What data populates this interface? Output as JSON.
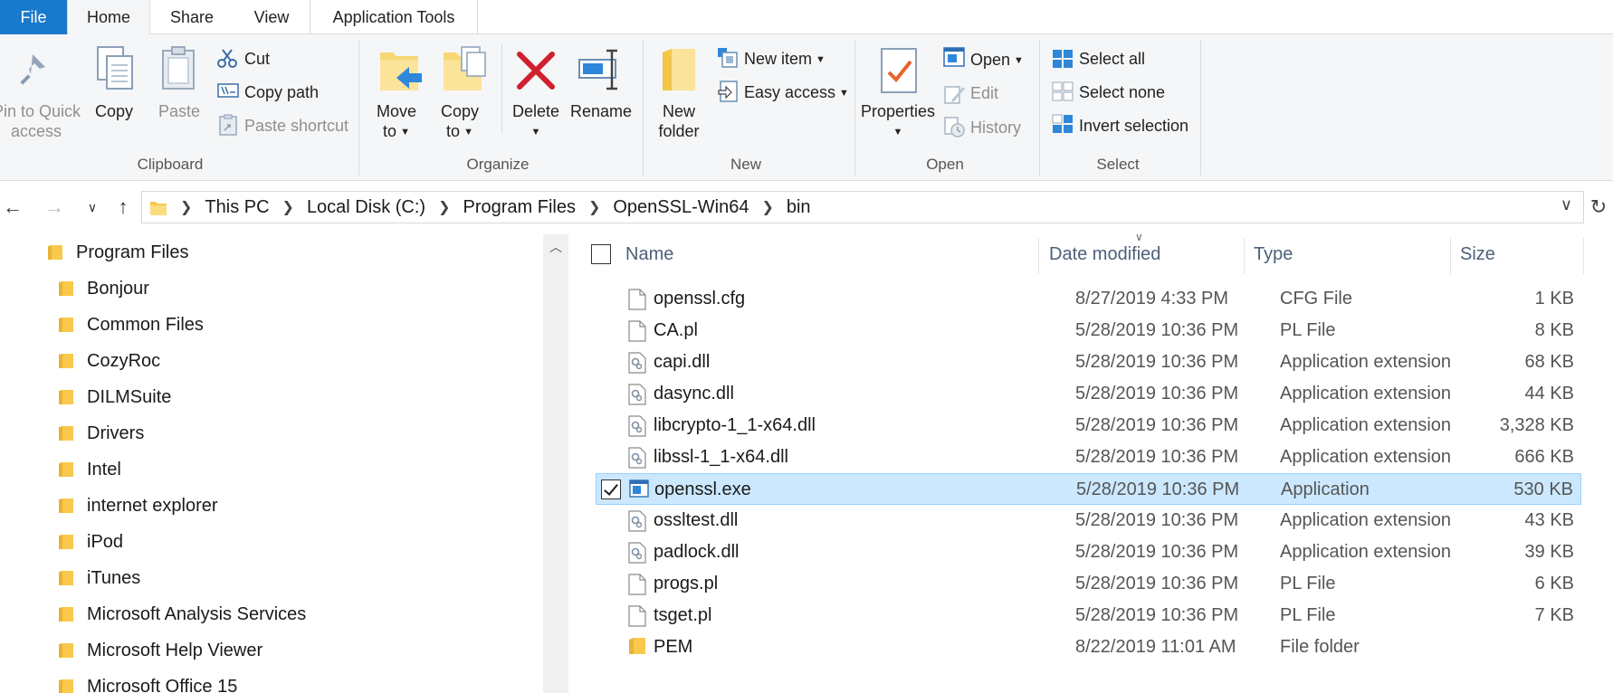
{
  "tabs": {
    "file": "File",
    "home": "Home",
    "share": "Share",
    "view": "View",
    "app_tools": "Application Tools"
  },
  "ribbon": {
    "clipboard": {
      "group_title": "Clipboard",
      "pin_line1": "Pin to Quick",
      "pin_line2": "access",
      "copy": "Copy",
      "paste": "Paste",
      "cut": "Cut",
      "copy_path": "Copy path",
      "paste_shortcut": "Paste shortcut"
    },
    "organize": {
      "group_title": "Organize",
      "move_to_line1": "Move",
      "move_to_line2": "to",
      "copy_to_line1": "Copy",
      "copy_to_line2": "to",
      "delete": "Delete",
      "rename": "Rename"
    },
    "new": {
      "group_title": "New",
      "new_folder_line1": "New",
      "new_folder_line2": "folder",
      "new_item": "New item",
      "easy_access": "Easy access"
    },
    "open": {
      "group_title": "Open",
      "properties": "Properties",
      "open": "Open",
      "edit": "Edit",
      "history": "History"
    },
    "select": {
      "group_title": "Select",
      "select_all": "Select all",
      "select_none": "Select none",
      "invert_selection": "Invert selection"
    }
  },
  "address": {
    "crumbs": [
      "This PC",
      "Local Disk (C:)",
      "Program Files",
      "OpenSSL-Win64",
      "bin"
    ]
  },
  "tree": {
    "root": "Program Files",
    "items": [
      "Bonjour",
      "Common Files",
      "CozyRoc",
      "DILMSuite",
      "Drivers",
      "Intel",
      "internet explorer",
      "iPod",
      "iTunes",
      "Microsoft Analysis Services",
      "Microsoft Help Viewer",
      "Microsoft Office 15"
    ]
  },
  "columns": {
    "name": "Name",
    "date": "Date modified",
    "type": "Type",
    "size": "Size"
  },
  "files": [
    {
      "name": "openssl.cfg",
      "date": "8/27/2019 4:33 PM",
      "type": "CFG File",
      "size": "1 KB",
      "icon": "file-icon"
    },
    {
      "name": "CA.pl",
      "date": "5/28/2019 10:36 PM",
      "type": "PL File",
      "size": "8 KB",
      "icon": "file-icon"
    },
    {
      "name": "capi.dll",
      "date": "5/28/2019 10:36 PM",
      "type": "Application extension",
      "size": "68 KB",
      "icon": "dll-icon"
    },
    {
      "name": "dasync.dll",
      "date": "5/28/2019 10:36 PM",
      "type": "Application extension",
      "size": "44 KB",
      "icon": "dll-icon"
    },
    {
      "name": "libcrypto-1_1-x64.dll",
      "date": "5/28/2019 10:36 PM",
      "type": "Application extension",
      "size": "3,328 KB",
      "icon": "dll-icon"
    },
    {
      "name": "libssl-1_1-x64.dll",
      "date": "5/28/2019 10:36 PM",
      "type": "Application extension",
      "size": "666 KB",
      "icon": "dll-icon"
    },
    {
      "name": "openssl.exe",
      "date": "5/28/2019 10:36 PM",
      "type": "Application",
      "size": "530 KB",
      "icon": "exe-icon",
      "selected": true
    },
    {
      "name": "ossltest.dll",
      "date": "5/28/2019 10:36 PM",
      "type": "Application extension",
      "size": "43 KB",
      "icon": "dll-icon"
    },
    {
      "name": "padlock.dll",
      "date": "5/28/2019 10:36 PM",
      "type": "Application extension",
      "size": "39 KB",
      "icon": "dll-icon"
    },
    {
      "name": "progs.pl",
      "date": "5/28/2019 10:36 PM",
      "type": "PL File",
      "size": "6 KB",
      "icon": "file-icon"
    },
    {
      "name": "tsget.pl",
      "date": "5/28/2019 10:36 PM",
      "type": "PL File",
      "size": "7 KB",
      "icon": "file-icon"
    },
    {
      "name": "PEM",
      "date": "8/22/2019 11:01 AM",
      "type": "File folder",
      "size": "",
      "icon": "folder-icon"
    }
  ],
  "colors": {
    "accent": "#1979ca",
    "selection": "#cce8ff",
    "folder": "#f8c94c"
  }
}
